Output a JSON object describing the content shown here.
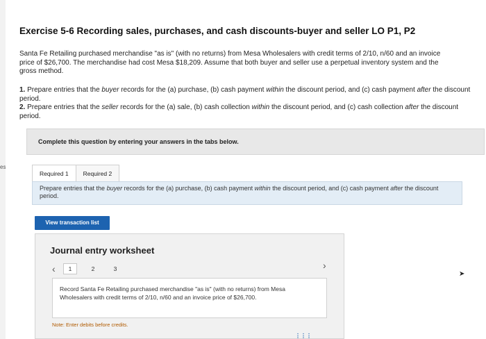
{
  "edge_text": "es",
  "title": "Exercise 5-6 Recording sales, purchases, and cash discounts-buyer and seller LO P1, P2",
  "intro": "Santa Fe Retailing purchased merchandise \"as is\" (with no returns) from Mesa Wholesalers with credit terms of 2/10, n/60 and an invoice price of $26,700. The merchandise had cost Mesa $18,209. Assume that both buyer and seller use a perpetual inventory system and the gross method.",
  "requirements": {
    "r1_num": "1.",
    "r1_a": " Prepare entries that the ",
    "r1_em": "buyer",
    "r1_b": " records for the (a) purchase, (b) cash payment ",
    "r1_em2": "within",
    "r1_c": " the discount period, and (c) cash payment ",
    "r1_em3": "after",
    "r1_d": " the discount period.",
    "r2_num": "2.",
    "r2_a": " Prepare entries that the ",
    "r2_em": "seller",
    "r2_b": " records for the (a) sale, (b) cash collection ",
    "r2_em2": "within",
    "r2_c": " the discount period, and (c) cash collection ",
    "r2_em3": "after",
    "r2_d": " the discount period."
  },
  "complete_box": "Complete this question by entering your answers in the tabs below.",
  "tabs": [
    {
      "label": "Required 1"
    },
    {
      "label": "Required 2"
    }
  ],
  "prompt": {
    "a": "Prepare entries that the ",
    "em": "buyer",
    "b": " records for the (a) purchase, (b) cash payment ",
    "em2": "within",
    "c": " the discount period, and (c) cash payment ",
    "em3": "after",
    "d": " the discount period."
  },
  "view_button": "View transaction list",
  "worksheet": {
    "title": "Journal entry worksheet",
    "pages": [
      "1",
      "2",
      "3"
    ],
    "description": "Record Santa Fe Retailing purchased merchandise \"as is\" (with no returns) from Mesa Wholesalers with credit terms of 2/10, n/60 and an invoice price of $26,700.",
    "note": "Note: Enter debits before credits."
  },
  "icons": {
    "prev": "chevron-left-icon",
    "next": "chevron-right-icon",
    "cursor": "mouse-cursor-icon",
    "more": "more-dots-icon"
  }
}
